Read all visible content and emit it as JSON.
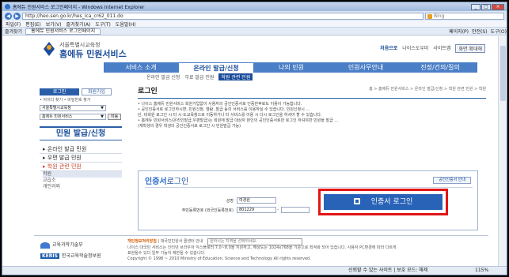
{
  "browser": {
    "title": "홈에듀 민원서비스 로그인페이지 - Windows Internet Explorer",
    "url": "http://heo.sen.go.kr/hes_ica_cr62_011.do",
    "search_placeholder": "Bing",
    "menu": [
      "파일(F)",
      "편집(E)",
      "보기(V)",
      "즐겨찾기(A)",
      "도구(T)",
      "도움말(H)"
    ],
    "favorites": "즐겨찾기",
    "tab_label": "홈에듀 민원서비스 로그인페이지",
    "commands": [
      "페이지(P)",
      "안전(S)",
      "도구(O)"
    ],
    "status_done": "",
    "status_zone": "신뢰할 수 있는 사이트 | 보호 모드: 해제",
    "zoom": "115%"
  },
  "site": {
    "logo_small": "서울특별시교육청",
    "logo_big": "홈에듀 민원서비스",
    "toplinks": [
      "처음으로",
      "나이스도우미",
      "사이트맵",
      "화면 확대해"
    ],
    "nav": [
      "서비스 소개",
      "온라인 발급/신청",
      "나의 민원",
      "민원사무안내",
      "진정/건의/질의"
    ],
    "subnav": [
      "온라인 발급 신청",
      "무료 발급 민원",
      "학원 관련 민원"
    ]
  },
  "left": {
    "login_btn": "로그인",
    "join_btn": "회원가입",
    "find": "• 아이디 찾기  • 비밀번호 찾기",
    "region_select": "서울특별시교육청",
    "service_select": "홈에듀 민원서비스",
    "go_btn": "이동",
    "title": "민원 발급/신청",
    "menu": [
      "온라인 발급 민원",
      "우편 발급 민원",
      "학원 관련 민원"
    ],
    "sub": [
      "학원",
      "교습소",
      "개인과외"
    ]
  },
  "content": {
    "title": "로그인",
    "breadcrumb": "홈 > 홈에듀 민원서비스 > 온라인 발급/신청 > 학원 관련 민원 > 학원",
    "notice": [
      "• 나이스 홈에듀 민원서비스 회원가입없이 사용자의 공인인증서로 인증한후로도 이용이 가능합니다.",
      "• 공인인증서로 로그인하시면, 민원신청, 열람 ,발급 등의 서비스를 이용하실 수 있습니다. 민원신청시 ...",
      "  단, 비회원 로그인 시 타 시·도교육청으로 이동하거나 타 서비스를 이용 시 다시 로그인을 하셔야 할 수 있습니다.",
      "• 홈에듀 민원서비스(온라인발급,우편발급)는 회원에 발급 대상자 본인의 공인인증서로만 로그인 하셔야만 민원을 발급 ...",
      "  (재학생의 경우 학생의 공인인증서로 로그인 시 민원발급 가능)"
    ]
  },
  "cert": {
    "title_prefix": "인증서",
    "title_suffix": "로그인",
    "guide_btn": "공인인증서 안내",
    "name_label": "성명",
    "name_value": "여경원",
    "rrn_label": "주민등록번호 (외국인등록번호)",
    "rrn_value": "801229",
    "login_btn": "인증서 로그인"
  },
  "footer": {
    "org1": "교육과학기술부",
    "org2_brand": "KERIS",
    "org2": "한국교육학술정보원",
    "privacy": "개인정보처리방침",
    "contact": "대국민민원서 콜센터 안내",
    "region_select": "원하시는 지역을 선택하세요.",
    "line2": "나이스 대국민 서비스는 인터넷 브라우저 익스플로러 7.0~8.0을 지원하고, 해상도는 1024x768을 기준으로 최적화 되어 있습니다. 사용자 PC환경에 따라 다르게",
    "line3": "표현될수 있다 일부 기능이 제한될 수 있습니다.",
    "copyright": "Copyright © 1998 ~ 2010 Ministry of Education, Science and Technology All rights reserved."
  }
}
